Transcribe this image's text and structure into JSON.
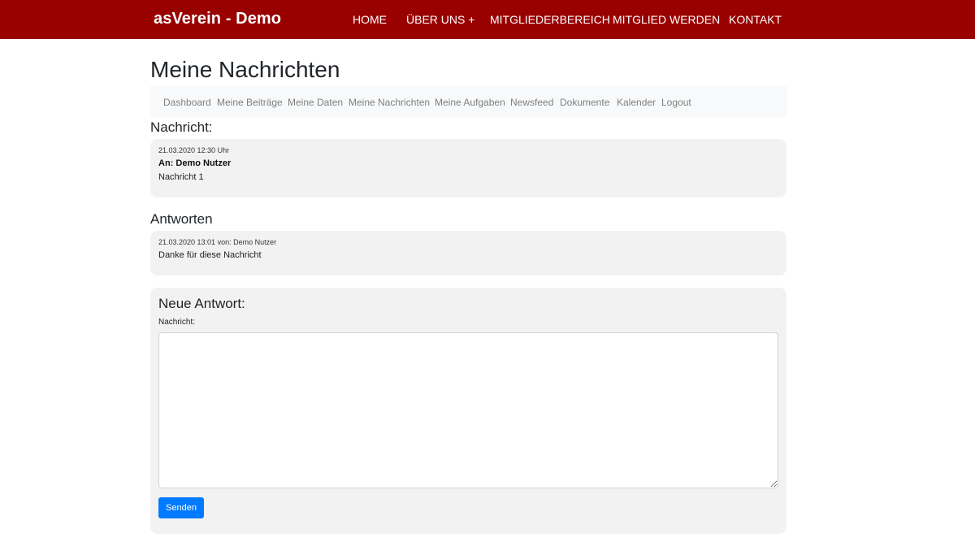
{
  "header": {
    "brand": "asVerein - Demo",
    "nav": [
      {
        "label": "HOME"
      },
      {
        "label": "ÜBER UNS +"
      },
      {
        "label": "MITGLIEDERBEREICH"
      },
      {
        "label": "MITGLIED WERDEN"
      },
      {
        "label": "KONTAKT"
      }
    ],
    "background_color": "#990000"
  },
  "page": {
    "title": "Meine Nachrichten"
  },
  "subnav": {
    "items": [
      {
        "label": "Dashboard"
      },
      {
        "label": "Meine Beiträge"
      },
      {
        "label": "Meine Daten"
      },
      {
        "label": "Meine Nachrichten"
      },
      {
        "label": "Meine Aufgaben"
      },
      {
        "label": "Newsfeed"
      },
      {
        "label": "Dokumente"
      },
      {
        "label": "Kalender"
      },
      {
        "label": "Logout"
      }
    ]
  },
  "message": {
    "section_title": "Nachricht:",
    "timestamp": "21.03.2020 12:30 Uhr",
    "recipient": "An: Demo Nutzer",
    "body": "Nachricht 1"
  },
  "answers": {
    "section_title": "Antworten",
    "items": [
      {
        "meta": "21.03.2020 13:01 von: Demo Nutzer",
        "body": "Danke für diese Nachricht"
      }
    ]
  },
  "reply": {
    "title": "Neue Antwort:",
    "field_label": "Nachricht:",
    "value": "",
    "send_label": "Senden",
    "send_color": "#007bff"
  }
}
